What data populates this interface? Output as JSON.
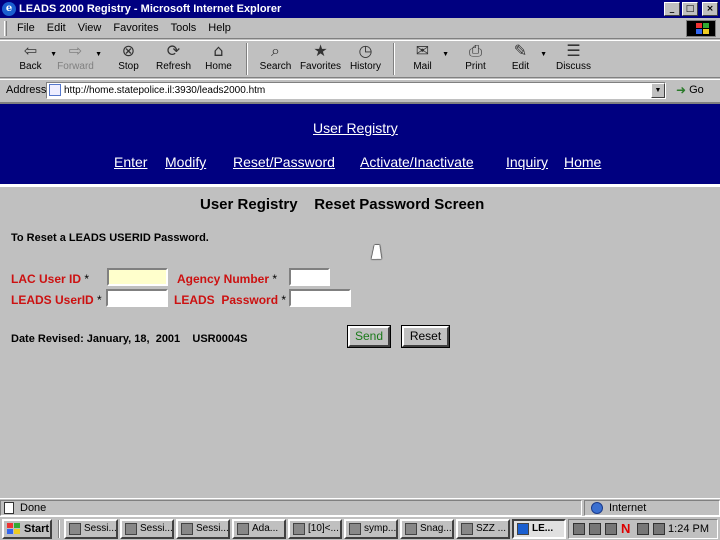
{
  "window": {
    "title": "LEADS 2000 Registry - Microsoft Internet Explorer",
    "controls": {
      "minimize": "_",
      "maximize": "□",
      "close": "×"
    }
  },
  "menu": [
    "File",
    "Edit",
    "View",
    "Favorites",
    "Tools",
    "Help"
  ],
  "toolbar": [
    {
      "label": "Back",
      "icon": "back-arrow-icon",
      "glyph": "⇦",
      "enabled": true
    },
    {
      "label": "Forward",
      "icon": "forward-arrow-icon",
      "glyph": "⇨",
      "enabled": false
    },
    {
      "label": "Stop",
      "icon": "stop-icon",
      "glyph": "⊗",
      "enabled": true
    },
    {
      "label": "Refresh",
      "icon": "refresh-icon",
      "glyph": "⟳",
      "enabled": true
    },
    {
      "label": "Home",
      "icon": "home-icon",
      "glyph": "⌂",
      "enabled": true
    },
    {
      "label": "Search",
      "icon": "search-icon",
      "glyph": "⌕",
      "enabled": true
    },
    {
      "label": "Favorites",
      "icon": "favorites-icon",
      "glyph": "★",
      "enabled": true
    },
    {
      "label": "History",
      "icon": "history-icon",
      "glyph": "◷",
      "enabled": true
    },
    {
      "label": "Mail",
      "icon": "mail-icon",
      "glyph": "✉",
      "enabled": true
    },
    {
      "label": "Print",
      "icon": "print-icon",
      "glyph": "⎙",
      "enabled": true
    },
    {
      "label": "Edit",
      "icon": "edit-icon",
      "glyph": "✎",
      "enabled": true
    },
    {
      "label": "Discuss",
      "icon": "discuss-icon",
      "glyph": "☰",
      "enabled": true
    }
  ],
  "address": {
    "label": "Address",
    "url": "http://home.statepolice.il:3930/leads2000.htm",
    "go_label": "Go"
  },
  "page": {
    "registry_link": "User Registry",
    "nav": [
      "Enter",
      "Modify",
      "Reset/Password",
      "Activate/Inactivate",
      "Inquiry",
      "Home"
    ],
    "heading": "User Registry    Reset Password Screen",
    "intro": "To Reset a LEADS USERID Password.",
    "fields": {
      "lac_user_id": "LAC User ID",
      "agency_number": "Agency Number",
      "leads_userid": "LEADS UserID",
      "leads_password": "LEADS  Password",
      "required_mark": "*"
    },
    "revised": "Date Revised: January, 18,  2001    USR0004S",
    "send_label": "Send",
    "reset_label": "Reset"
  },
  "status": {
    "text": "Done",
    "zone": "Internet"
  },
  "taskbar": {
    "start_label": "Start",
    "tasks": [
      "Sessi...",
      "Sessi...",
      "Sessi...",
      "Ada...",
      "[10]<...",
      "symp...",
      "Snag...",
      "SZZ ...",
      "LE..."
    ],
    "active_task": 8,
    "clock": "1:24 PM"
  },
  "colors": {
    "titlebar": "#000080",
    "nav_band": "#000080",
    "field_label": "#cc1111",
    "send_text": "#1a7a1a",
    "focused_input": "#ffffcc"
  }
}
